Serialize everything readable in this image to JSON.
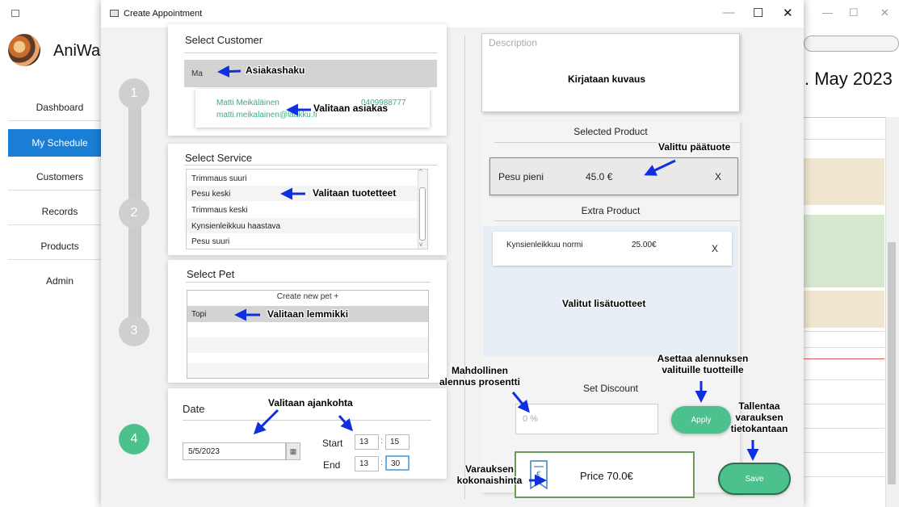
{
  "background_app": {
    "app_name": "AniWa",
    "month_label": ". May 2023",
    "sidebar": [
      {
        "label": "Dashboard",
        "active": false
      },
      {
        "label": "My Schedule",
        "active": true
      },
      {
        "label": "Customers",
        "active": false
      },
      {
        "label": "Records",
        "active": false
      },
      {
        "label": "Products",
        "active": false
      },
      {
        "label": "Admin",
        "active": false
      }
    ],
    "accent_color": "#1a7ed6"
  },
  "dialog": {
    "title": "Create Appointment",
    "steps": [
      "1",
      "2",
      "3",
      "4"
    ],
    "current_step": "4",
    "customer": {
      "heading": "Select Customer",
      "search_value": "Ma",
      "result_name": "Matti Meikäläinen",
      "result_phone": "0409988777",
      "result_email": "matti.meikalainen@laakku.fi"
    },
    "service": {
      "heading": "Select Service",
      "items": [
        "Trimmaus suuri",
        "Pesu keski",
        "Trimmaus keski",
        "Kynsienleikkuu haastava",
        "Pesu suuri"
      ]
    },
    "pet": {
      "heading": "Select Pet",
      "create_new": "Create new pet  +",
      "selected": "Topi"
    },
    "date": {
      "heading": "Date",
      "value": "5/5/2023",
      "start_label": "Start",
      "start_hour": "13",
      "start_min": "15",
      "end_label": "End",
      "end_hour": "13",
      "end_min": "30",
      "time_sep": ":"
    },
    "description": {
      "placeholder": "Description"
    },
    "selected_product": {
      "heading": "Selected Product",
      "name": "Pesu pieni",
      "price": "45.0 €",
      "remove": "X"
    },
    "extra_product": {
      "heading": "Extra Product",
      "name": "Kynsienleikkuu normi",
      "price": "25.00€",
      "remove": "X"
    },
    "discount": {
      "heading": "Set Discount",
      "placeholder": "0 %",
      "apply_label": "Apply"
    },
    "price_text": "Price 70.0€",
    "save_label": "Save",
    "accent_color": "#4cc08d"
  },
  "annotations": {
    "customer_search": "Asiakashaku",
    "pick_customer": "Valitaan asiakas",
    "pick_products": "Valitaan tuotetteet",
    "pick_pet": "Valitaan lemmikki",
    "pick_time": "Valitaan ajankohta",
    "write_description": "Kirjataan kuvaus",
    "main_product": "Valittu päätuote",
    "extra_products": "Valitut lisätuotteet",
    "discount_line1": "Mahdollinen",
    "discount_line2": "alennus prosentti",
    "apply_line1": "Asettaa alennuksen",
    "apply_line2": "valituille tuotteille",
    "save_line1": "Tallentaa",
    "save_line2": "varauksen",
    "save_line3": "tietokantaan",
    "total_line1": "Varauksen",
    "total_line2": "kokonaishinta",
    "arrow_color": "#1030e0"
  }
}
